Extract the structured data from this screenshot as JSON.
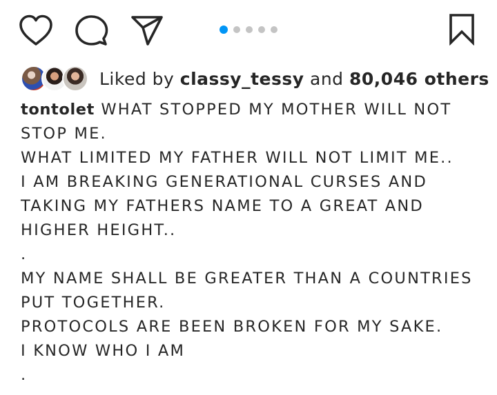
{
  "actions": {
    "like_icon": "heart-outline",
    "comment_icon": "comment-bubble",
    "share_icon": "paper-plane",
    "save_icon": "bookmark-outline"
  },
  "carousel": {
    "total": 5,
    "active_index": 0,
    "active_color": "#0095f6",
    "inactive_color": "#c4c4c4"
  },
  "likes": {
    "prefix": "Liked by",
    "user": "classy_tessy",
    "joiner": "and",
    "count": "80,046 others"
  },
  "caption": {
    "username": "tontolet",
    "lines": [
      "WHAT STOPPED MY MOTHER WILL NOT STOP ME.",
      "WHAT LIMITED MY FATHER WILL NOT LIMIT ME..",
      "I AM BREAKING GENERATIONAL CURSES AND",
      "TAKING MY FATHERS NAME TO A GREAT AND",
      "HIGHER HEIGHT..",
      ".",
      "MY NAME SHALL BE GREATER THAN A COUNTRIES",
      "PUT TOGETHER.",
      "PROTOCOLS ARE BEEN BROKEN FOR MY SAKE.",
      "I KNOW WHO I AM",
      "."
    ]
  }
}
